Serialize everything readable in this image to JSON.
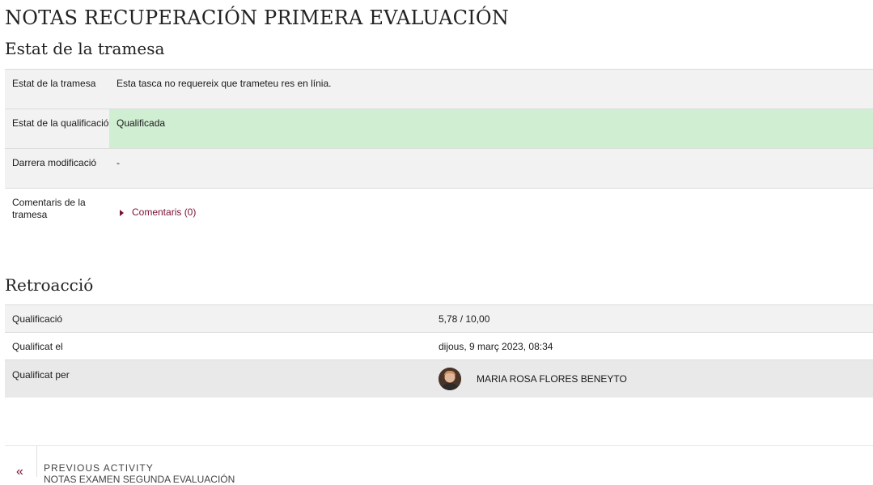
{
  "page": {
    "title": "NOTAS RECUPERACIÓN PRIMERA EVALUACIÓN"
  },
  "submission_status": {
    "heading": "Estat de la tramesa",
    "rows": [
      {
        "label": "Estat de la tramesa",
        "value": "Esta tasca no requereix que trameteu res en línia."
      },
      {
        "label": "Estat de la qualificació",
        "value": "Qualificada",
        "status_color": "#d0eed1"
      },
      {
        "label": "Darrera modificació",
        "value": "-"
      },
      {
        "label": "Comentaris de la tramesa",
        "value": "Comentaris (0)"
      }
    ]
  },
  "feedback": {
    "heading": "Retroacció",
    "rows": [
      {
        "label": "Qualificació",
        "value": "5,78 / 10,00"
      },
      {
        "label": "Qualificat el",
        "value": "dijous, 9 març 2023, 08:34"
      },
      {
        "label": "Qualificat per",
        "value": "MARIA ROSA FLORES BENEYTO",
        "icon": "user-avatar"
      }
    ]
  },
  "navigation": {
    "prev_arrow": "«",
    "prev_label": "PREVIOUS ACTIVITY",
    "prev_title": "NOTAS EXAMEN SEGUNDA EVALUACIÓN"
  },
  "colors": {
    "accent": "#7a1036",
    "graded_bg": "#d0eed1",
    "row_bg": "#f2f2f2"
  }
}
